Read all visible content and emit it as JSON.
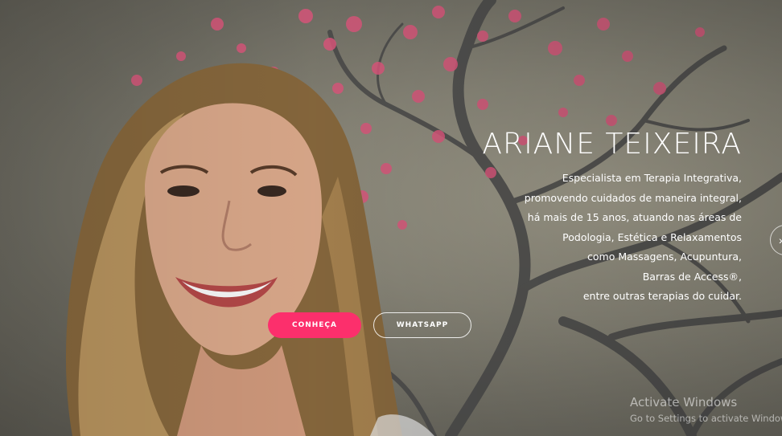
{
  "hero": {
    "title": "ARIANE TEIXEIRA",
    "description_lines": [
      "Especialista em Terapia Integrativa,",
      "promovendo cuidados de maneira integral,",
      "há mais de 15 anos, atuando nas áreas de",
      "Podologia, Estética e Relaxamentos",
      "como Massagens, Acupuntura,",
      "Barras de Access®,",
      "entre outras terapias do cuidar."
    ],
    "buttons": {
      "primary_label": "CONHEÇA",
      "secondary_label": "WHATSAPP"
    },
    "slider_next_icon": "chevron-right-icon"
  },
  "os_watermark": {
    "title": "Activate Windows",
    "subtitle": "Go to Settings to activate Windows."
  },
  "colors": {
    "accent": "#fc2f6c",
    "text": "#ffffff",
    "blossom": "#e0597f"
  }
}
